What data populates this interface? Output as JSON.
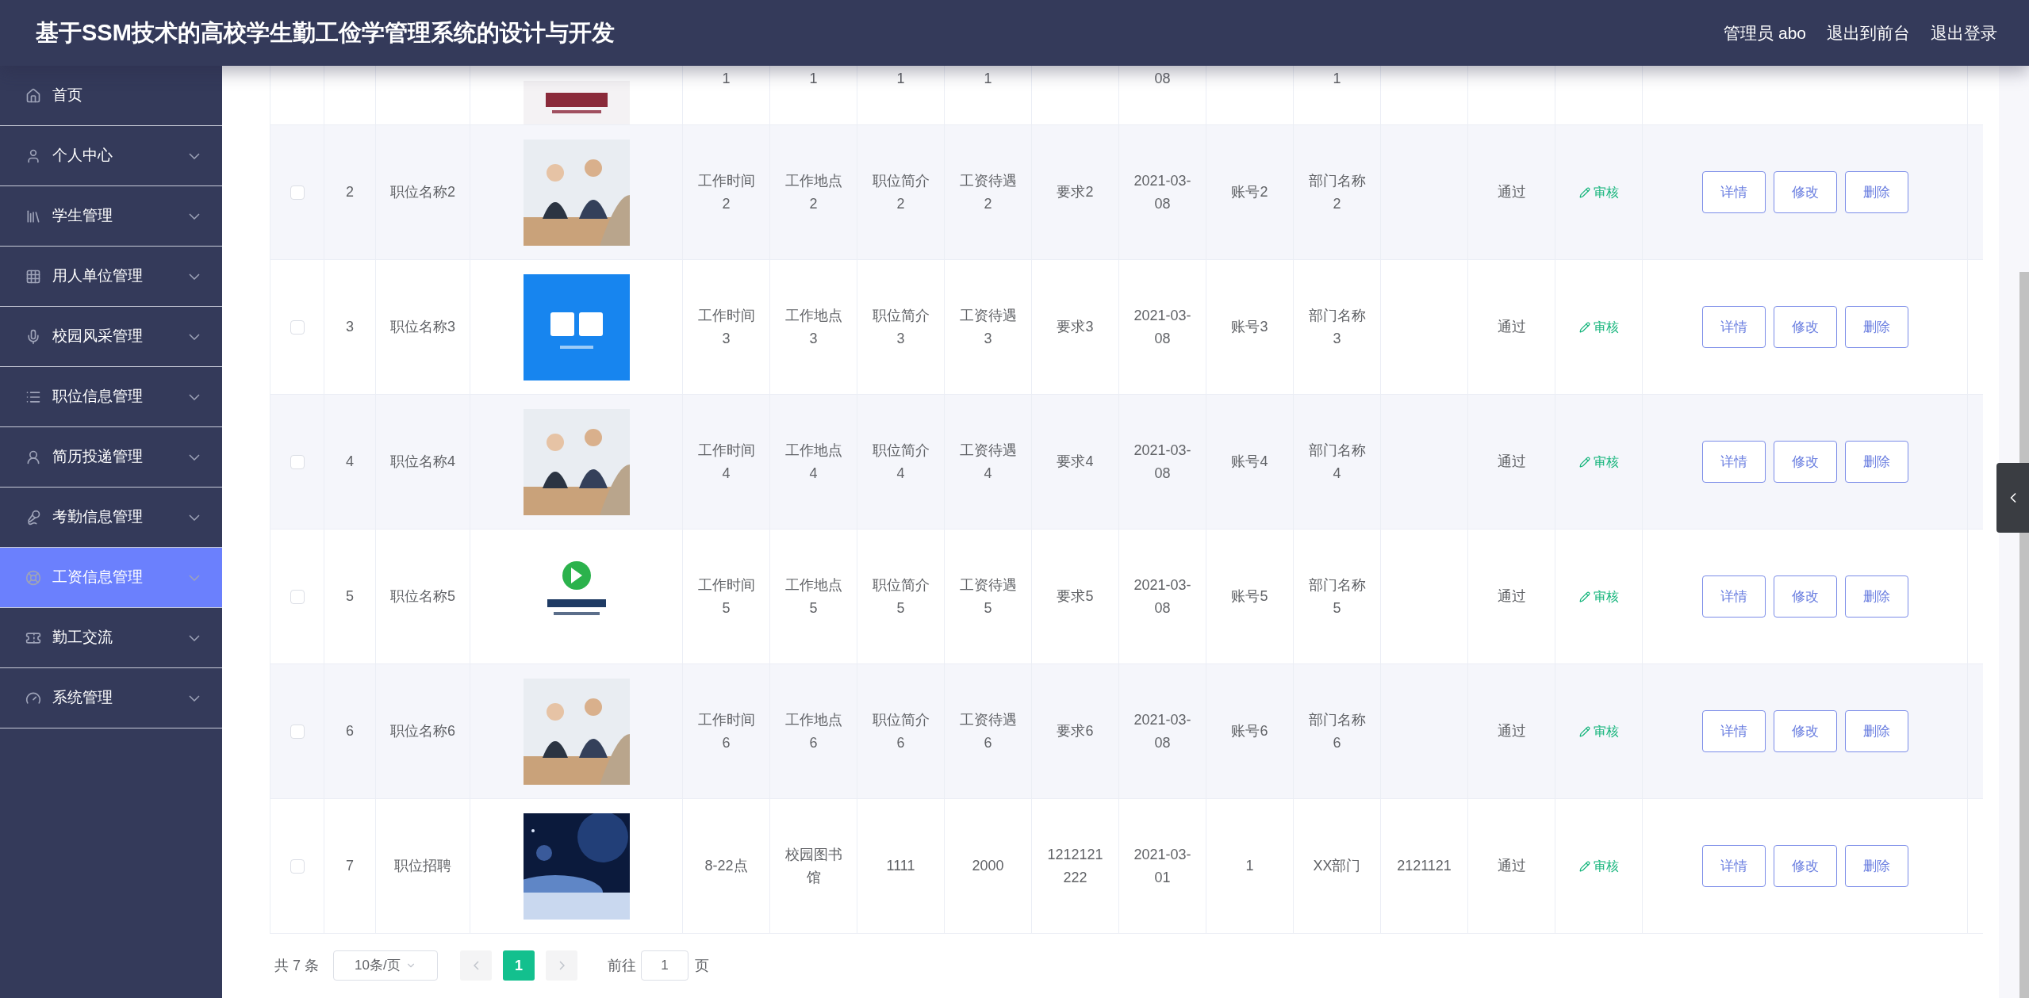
{
  "header": {
    "title": "基于SSM技术的高校学生勤工俭学管理系统的设计与开发",
    "links": [
      "管理员 abo",
      "退出到前台",
      "退出登录"
    ]
  },
  "sidebar": {
    "items": [
      {
        "label": "首页",
        "kind": "link",
        "selected": false
      },
      {
        "label": "个人中心",
        "kind": "submenu",
        "selected": false
      },
      {
        "label": "学生管理",
        "kind": "submenu",
        "selected": false
      },
      {
        "label": "用人单位管理",
        "kind": "submenu",
        "selected": false
      },
      {
        "label": "校园风采管理",
        "kind": "submenu",
        "selected": false
      },
      {
        "label": "职位信息管理",
        "kind": "submenu",
        "selected": false
      },
      {
        "label": "简历投递管理",
        "kind": "submenu",
        "selected": false
      },
      {
        "label": "考勤信息管理",
        "kind": "submenu",
        "selected": false
      },
      {
        "label": "工资信息管理",
        "kind": "submenu",
        "selected": true
      },
      {
        "label": "勤工交流",
        "kind": "submenu",
        "selected": false
      },
      {
        "label": "系统管理",
        "kind": "submenu",
        "selected": false
      }
    ]
  },
  "table": {
    "rows": [
      {
        "kind": "partial",
        "cells": [
          "1",
          "1",
          "1",
          "1",
          null,
          "08",
          null,
          "1",
          null
        ]
      },
      {
        "kind": "full",
        "checked": false,
        "index": "2",
        "name": "职位名称2",
        "cells": [
          "工作时间2",
          "工作地点2",
          "职位简介2",
          "工资待遇2",
          "要求2",
          "2021-03-08",
          "账号2",
          "部门名称2",
          null
        ],
        "status": "通过",
        "review": "审核",
        "actions": [
          "详情",
          "修改",
          "删除"
        ]
      },
      {
        "kind": "full",
        "checked": false,
        "index": "3",
        "name": "职位名称3",
        "cells": [
          "工作时间3",
          "工作地点3",
          "职位简介3",
          "工资待遇3",
          "要求3",
          "2021-03-08",
          "账号3",
          "部门名称3",
          null
        ],
        "status": "通过",
        "review": "审核",
        "actions": [
          "详情",
          "修改",
          "删除"
        ]
      },
      {
        "kind": "full",
        "checked": false,
        "index": "4",
        "name": "职位名称4",
        "cells": [
          "工作时间4",
          "工作地点4",
          "职位简介4",
          "工资待遇4",
          "要求4",
          "2021-03-08",
          "账号4",
          "部门名称4",
          null
        ],
        "status": "通过",
        "review": "审核",
        "actions": [
          "详情",
          "修改",
          "删除"
        ]
      },
      {
        "kind": "full",
        "checked": false,
        "index": "5",
        "name": "职位名称5",
        "cells": [
          "工作时间5",
          "工作地点5",
          "职位简介5",
          "工资待遇5",
          "要求5",
          "2021-03-08",
          "账号5",
          "部门名称5",
          null
        ],
        "status": "通过",
        "review": "审核",
        "actions": [
          "详情",
          "修改",
          "删除"
        ]
      },
      {
        "kind": "full",
        "checked": false,
        "index": "6",
        "name": "职位名称6",
        "cells": [
          "工作时间6",
          "工作地点6",
          "职位简介6",
          "工资待遇6",
          "要求6",
          "2021-03-08",
          "账号6",
          "部门名称6",
          null
        ],
        "status": "通过",
        "review": "审核",
        "actions": [
          "详情",
          "修改",
          "删除"
        ]
      },
      {
        "kind": "full",
        "checked": false,
        "index": "7",
        "name": "职位招聘",
        "cells": [
          "8-22点",
          "校园图书馆",
          "1111",
          "2000",
          "1212121222",
          "2021-03-01",
          "1",
          "XX部门",
          "2121121"
        ],
        "status": "通过",
        "review": "审核",
        "actions": [
          "详情",
          "修改",
          "删除"
        ]
      }
    ]
  },
  "pagination": {
    "total": "共 7 条",
    "page_size": "10条/页",
    "pages": [
      {
        "label": "1",
        "selected": true
      }
    ],
    "goto_label": "前往",
    "goto_value": "1",
    "goto_suffix": "页"
  }
}
